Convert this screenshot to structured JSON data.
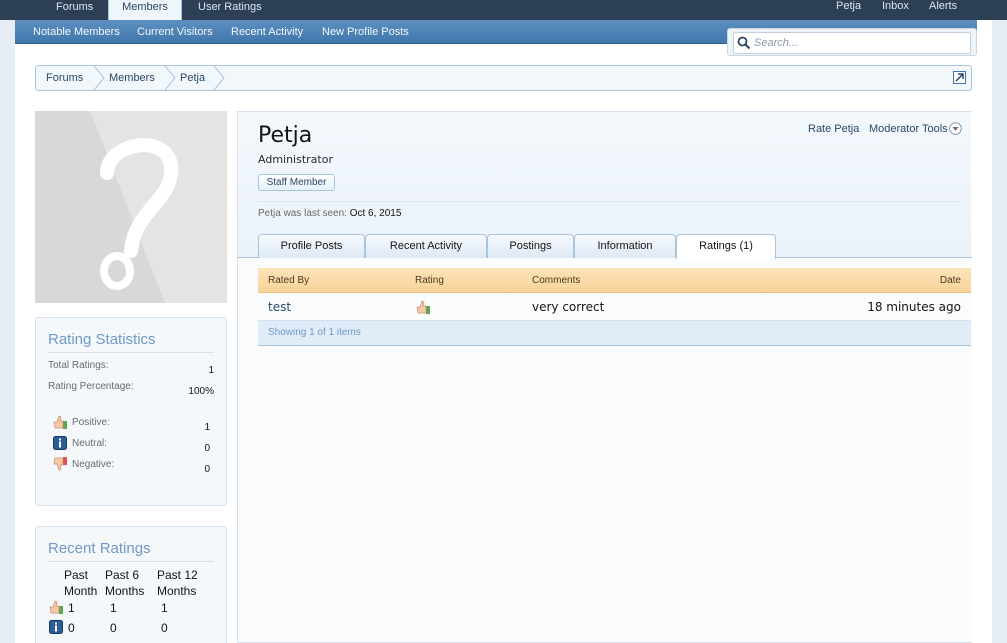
{
  "top_nav": {
    "tabs": [
      {
        "label": "Forums"
      },
      {
        "label": "Members"
      },
      {
        "label": "User Ratings"
      }
    ],
    "right_links": [
      {
        "label": "Petja"
      },
      {
        "label": "Inbox"
      },
      {
        "label": "Alerts"
      }
    ]
  },
  "sub_nav": {
    "links": [
      {
        "label": "Notable Members"
      },
      {
        "label": "Current Visitors"
      },
      {
        "label": "Recent Activity"
      },
      {
        "label": "New Profile Posts"
      }
    ]
  },
  "search": {
    "placeholder": "Search..."
  },
  "breadcrumb": [
    {
      "label": "Forums"
    },
    {
      "label": "Members"
    },
    {
      "label": "Petja"
    }
  ],
  "profile": {
    "name": "Petja",
    "title": "Administrator",
    "badge": "Staff Member",
    "actions": {
      "rate": "Rate Petja",
      "moderator": "Moderator Tools"
    },
    "last_seen_label": "Petja was last seen:",
    "last_seen_value": "Oct 6, 2015"
  },
  "tabs": [
    {
      "label": "Profile Posts"
    },
    {
      "label": "Recent Activity"
    },
    {
      "label": "Postings"
    },
    {
      "label": "Information"
    },
    {
      "label": "Ratings (1)"
    }
  ],
  "ratings_table": {
    "headers": {
      "rated_by": "Rated By",
      "rating": "Rating",
      "comments": "Comments",
      "date": "Date"
    },
    "rows": [
      {
        "rated_by": "test",
        "rating_icon": "thumbs-up-icon",
        "comments": "very correct",
        "date": "18 minutes ago"
      }
    ],
    "footer": "Showing 1 of 1 items"
  },
  "rating_statistics": {
    "title": "Rating Statistics",
    "total_label": "Total Ratings:",
    "total_value": "1",
    "percentage_label": "Rating Percentage:",
    "percentage_value": "100%",
    "positive_label": "Positive:",
    "positive_value": "1",
    "neutral_label": "Neutral:",
    "neutral_value": "0",
    "negative_label": "Negative:",
    "negative_value": "0"
  },
  "recent_ratings": {
    "title": "Recent Ratings",
    "columns": [
      {
        "line1": "Past",
        "line2": "Month"
      },
      {
        "line1": "Past 6",
        "line2": "Months"
      },
      {
        "line1": "Past 12",
        "line2": "Months"
      }
    ],
    "rows": [
      {
        "icon": "thumbs-up-icon",
        "values": [
          "1",
          "1",
          "1"
        ]
      },
      {
        "icon": "info-icon",
        "values": [
          "0",
          "0",
          "0"
        ]
      }
    ]
  },
  "colors": {
    "top_bar": "#2c3f55",
    "sub_bar": "#4177ad",
    "link": "#2b4866",
    "table_header": "#f8d39a",
    "sidebar_title": "#6f9ac5"
  }
}
